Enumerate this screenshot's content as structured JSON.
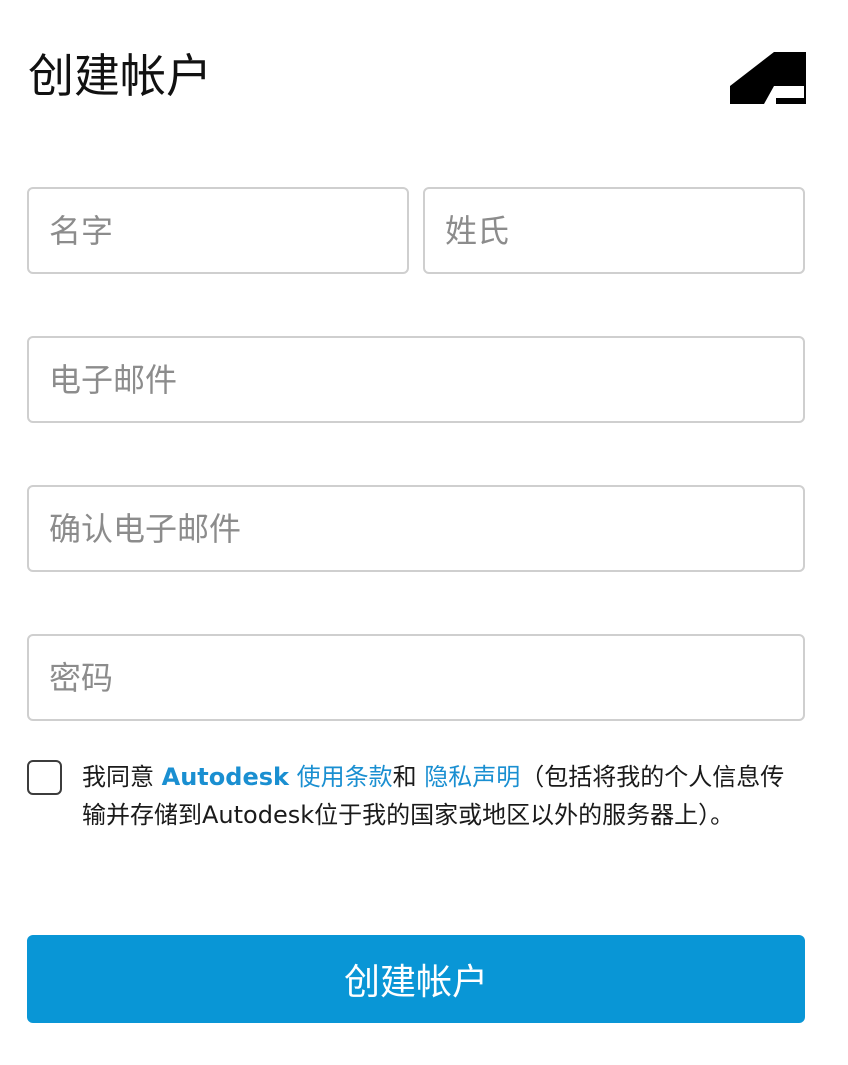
{
  "header": {
    "title": "创建帐户",
    "logo_icon": "autodesk-logo-icon"
  },
  "form": {
    "first_name": {
      "placeholder": "名字",
      "value": ""
    },
    "last_name": {
      "placeholder": "姓氏",
      "value": ""
    },
    "email": {
      "placeholder": "电子邮件",
      "value": ""
    },
    "confirm_email": {
      "placeholder": "确认电子邮件",
      "value": ""
    },
    "password": {
      "placeholder": "密码",
      "value": ""
    }
  },
  "consent": {
    "checked": false,
    "prefix": "我同意 ",
    "brand_link": "Autodesk",
    "terms_link": " 使用条款",
    "joiner": "和 ",
    "privacy_link": "隐私声明",
    "suffix": "（包括将我的个人信息传输并存储到Autodesk位于我的国家或地区以外的服务器上）。"
  },
  "submit": {
    "label": "创建帐户"
  },
  "colors": {
    "accent": "#0996d6",
    "link": "#1a8fd1",
    "border": "#cfcfcf",
    "placeholder": "#8c8c8c"
  }
}
